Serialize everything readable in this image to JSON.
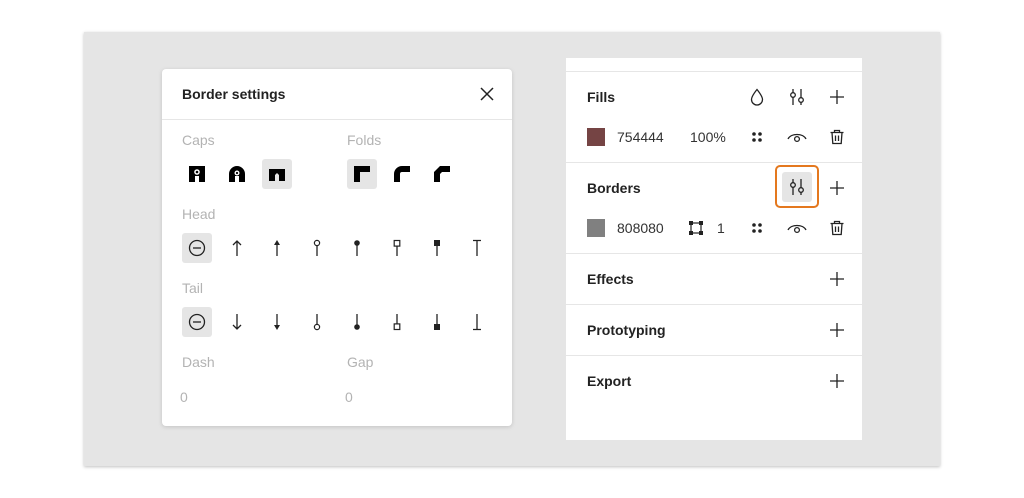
{
  "border_settings": {
    "title": "Border settings",
    "caps_label": "Caps",
    "folds_label": "Folds",
    "head_label": "Head",
    "tail_label": "Tail",
    "dash_label": "Dash",
    "gap_label": "Gap",
    "dash_value": "0",
    "gap_value": "0"
  },
  "panel": {
    "fills": {
      "title": "Fills",
      "color_hex": "754444",
      "color": "#754444",
      "opacity": "100%"
    },
    "borders": {
      "title": "Borders",
      "color_hex": "808080",
      "color": "#808080",
      "width": "1"
    },
    "effects_title": "Effects",
    "prototyping_title": "Prototyping",
    "export_title": "Export"
  }
}
